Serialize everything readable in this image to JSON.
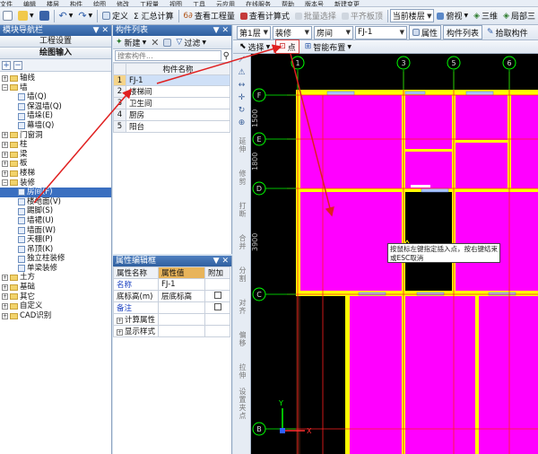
{
  "menu": {
    "items": [
      "文件",
      "编辑",
      "楼层",
      "构件",
      "绘图",
      "修改",
      "工程量",
      "视图",
      "工具",
      "云应用",
      "在线服务",
      "帮助",
      "版本号",
      "新建变更"
    ]
  },
  "toolbar1": {
    "define": "定义",
    "calc_sum": "Σ 汇总计算",
    "view_qty": "查看工程量",
    "view_formula": "查看计算式",
    "batch_select": "批量选择",
    "flat_plate": "平齐板顶",
    "floor_select": "当前楼层",
    "top_view": "俯视",
    "three_d": "三维",
    "local_3d": "局部三"
  },
  "nav": {
    "title": "模块导航栏",
    "pin": "▼ ✕",
    "btn_project": "工程设置",
    "btn_draw": "绘图输入",
    "tree": [
      {
        "label": "轴线",
        "pm": "+",
        "lvl": 0
      },
      {
        "label": "墙",
        "pm": "−",
        "lvl": 0
      },
      {
        "label": "墙(Q)",
        "lvl": 1
      },
      {
        "label": "保温墙(Q)",
        "lvl": 1
      },
      {
        "label": "墙垛(E)",
        "lvl": 1
      },
      {
        "label": "幕墙(Q)",
        "lvl": 1
      },
      {
        "label": "门窗洞",
        "pm": "+",
        "lvl": 0
      },
      {
        "label": "柱",
        "pm": "+",
        "lvl": 0
      },
      {
        "label": "梁",
        "pm": "+",
        "lvl": 0
      },
      {
        "label": "板",
        "pm": "+",
        "lvl": 0
      },
      {
        "label": "楼梯",
        "pm": "+",
        "lvl": 0
      },
      {
        "label": "装修",
        "pm": "−",
        "lvl": 0
      },
      {
        "label": "房间(F)",
        "lvl": 1,
        "selected": true
      },
      {
        "label": "楼地面(V)",
        "lvl": 1
      },
      {
        "label": "踢脚(S)",
        "lvl": 1
      },
      {
        "label": "墙裙(U)",
        "lvl": 1
      },
      {
        "label": "墙面(W)",
        "lvl": 1
      },
      {
        "label": "天棚(P)",
        "lvl": 1
      },
      {
        "label": "吊顶(K)",
        "lvl": 1
      },
      {
        "label": "独立柱装修",
        "lvl": 1
      },
      {
        "label": "单梁装修",
        "lvl": 1
      },
      {
        "label": "土方",
        "pm": "+",
        "lvl": 0
      },
      {
        "label": "基础",
        "pm": "+",
        "lvl": 0
      },
      {
        "label": "其它",
        "pm": "+",
        "lvl": 0
      },
      {
        "label": "自定义",
        "pm": "+",
        "lvl": 0
      },
      {
        "label": "CAD识别",
        "pm": "+",
        "lvl": 0
      }
    ]
  },
  "comp_list": {
    "title": "构件列表",
    "new": "新建",
    "filter": "过滤",
    "search_placeholder": "搜索构件...",
    "header": "构件名称",
    "rows": [
      {
        "n": "1",
        "name": "FJ-1"
      },
      {
        "n": "2",
        "name": "楼梯间"
      },
      {
        "n": "3",
        "name": "卫生间"
      },
      {
        "n": "4",
        "name": "厨房"
      },
      {
        "n": "5",
        "name": "阳台"
      }
    ]
  },
  "props": {
    "title": "属性编辑框",
    "col_name": "属性名称",
    "col_value": "属性值",
    "col_extra": "附加",
    "rows": [
      {
        "name": "名称",
        "value": "FJ-1",
        "blue": true
      },
      {
        "name": "底标高(m)",
        "value": "层底标高",
        "check": true
      },
      {
        "name": "备注",
        "value": "",
        "blue": true,
        "check": true
      },
      {
        "name": "计算属性",
        "pm": "+"
      },
      {
        "name": "显示样式",
        "pm": "+"
      }
    ]
  },
  "toolbar2": {
    "floor": "第1层",
    "category": "装修",
    "type": "房间",
    "item": "FJ-1",
    "properties": "属性",
    "comp_list": "构件列表",
    "pick": "拾取构件"
  },
  "toolbar3": {
    "select": "选择",
    "point": "点",
    "smart": "智能布置"
  },
  "left_tools": [
    "延伸",
    "修剪",
    "打断",
    "合并",
    "分割",
    "对齐",
    "偏移",
    "拉伸",
    "设置夹点"
  ],
  "canvas": {
    "axis_top": [
      "1",
      "3",
      "5",
      "6"
    ],
    "axis_left": [
      "F",
      "E",
      "D",
      "C",
      "B"
    ],
    "dims": [
      "1500",
      "1800",
      "3900"
    ],
    "hint": "按鼠标左键指定插入点，按右键结束或ESC取消",
    "ucs_x": "X",
    "ucs_y": "Y",
    "colors": {
      "bg": "#000000",
      "room": "#ff00ff",
      "wall": "#ffff00",
      "grid": "#ff0000",
      "axis": "#00ff00",
      "outline": "#7a3b24"
    }
  }
}
